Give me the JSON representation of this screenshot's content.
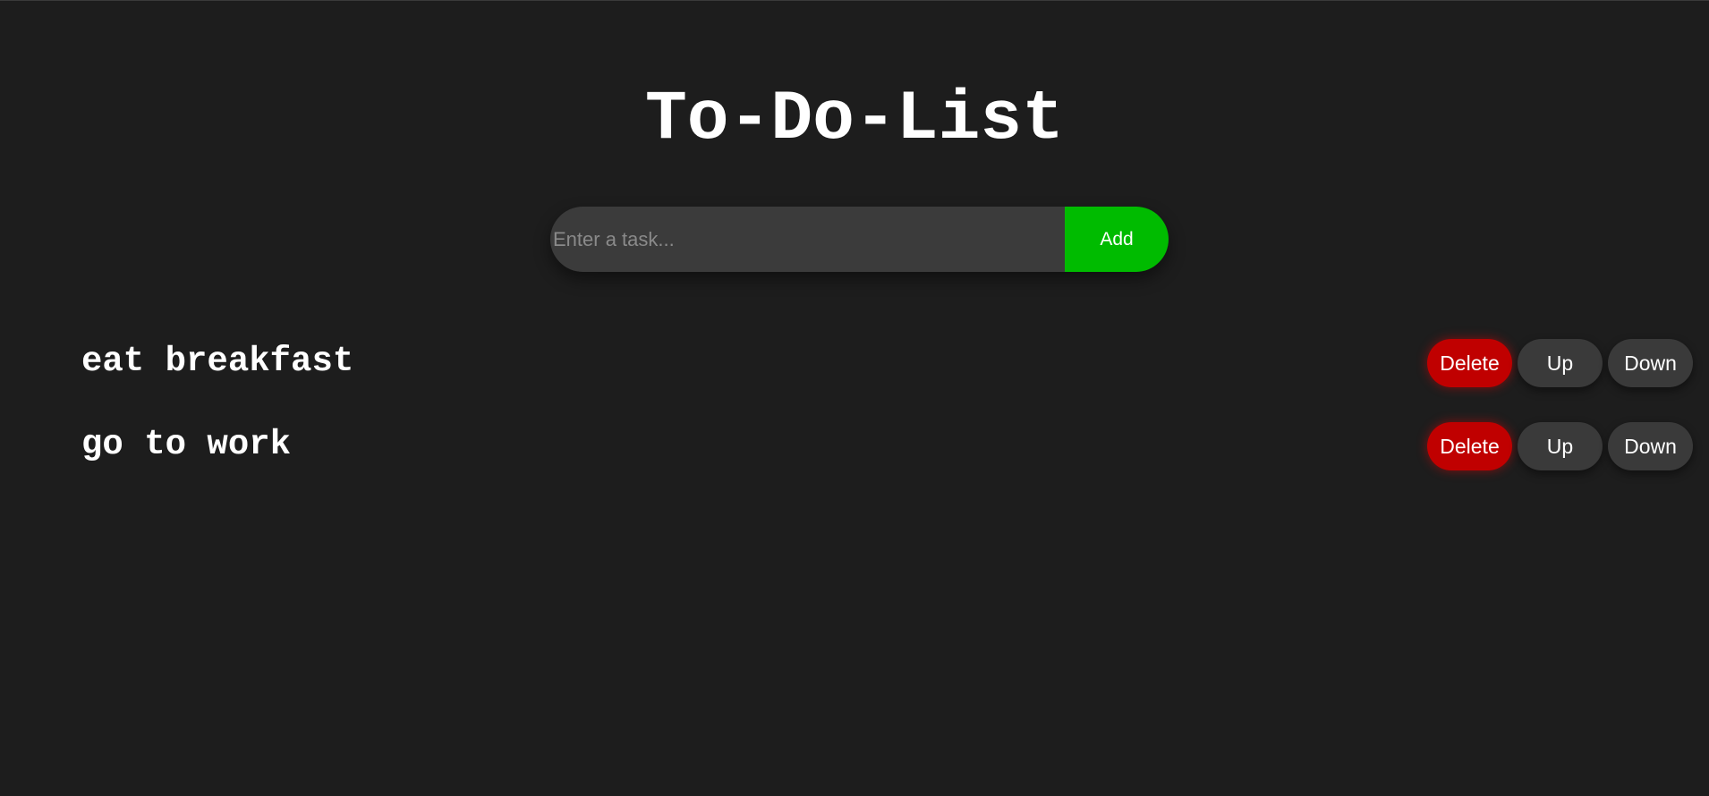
{
  "header": {
    "title": "To-Do-List"
  },
  "add_form": {
    "input_placeholder": "Enter a task...",
    "input_value": "",
    "add_label": "Add"
  },
  "tasks": [
    {
      "text": "eat breakfast",
      "delete_label": "Delete",
      "up_label": "Up",
      "down_label": "Down"
    },
    {
      "text": "go to work",
      "delete_label": "Delete",
      "up_label": "Up",
      "down_label": "Down"
    }
  ],
  "colors": {
    "background": "#1d1d1d",
    "input_background": "#3b3b3b",
    "add_button": "#00bb00",
    "delete_button": "#c00000",
    "move_button": "#3a3a3a",
    "text": "#ffffff"
  }
}
